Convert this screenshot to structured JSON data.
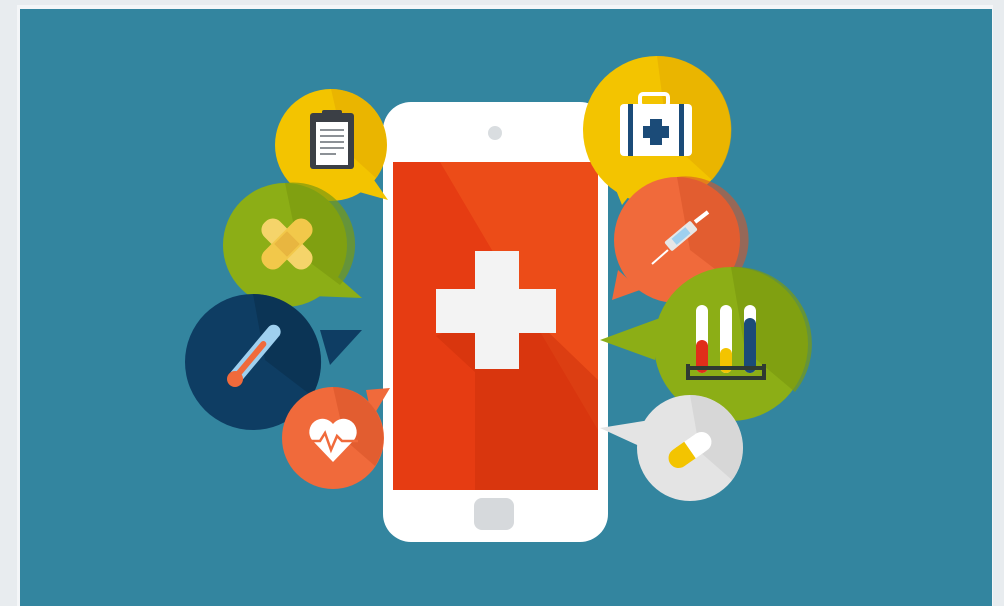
{
  "palette": {
    "background": "#33859f",
    "frame": "#f4f6f8",
    "phone_body": "#ffffff",
    "screen": "#e63e15",
    "cross": "#f3f3f3",
    "yellow": "#f3c400",
    "green": "#8cae16",
    "navy": "#0e3d63",
    "orange": "#f06a3b",
    "light_gray": "#e4e4e4"
  },
  "icons": [
    "smartphone-icon",
    "medical-cross-icon",
    "clipboard-icon",
    "bandage-icon",
    "thermometer-icon",
    "heartbeat-icon",
    "first-aid-kit-icon",
    "syringe-icon",
    "test-tubes-icon",
    "pill-icon"
  ]
}
